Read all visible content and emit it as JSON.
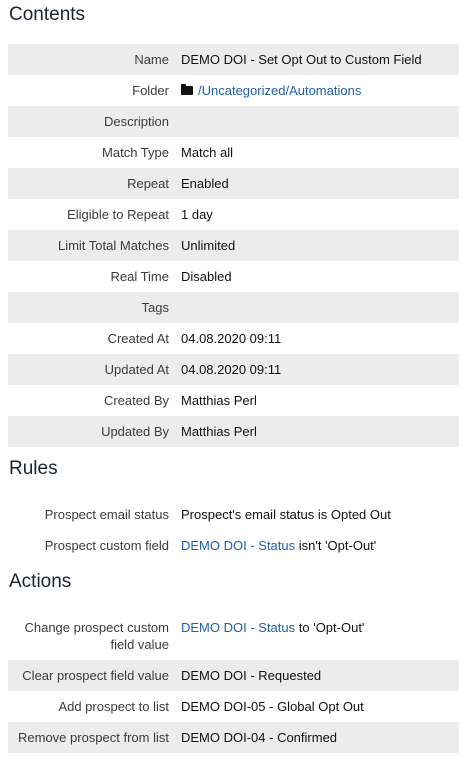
{
  "sections": {
    "contents": "Contents",
    "rules": "Rules",
    "actions": "Actions"
  },
  "contents": [
    {
      "label": "Name",
      "value": "DEMO DOI - Set Opt Out to Custom Field"
    },
    {
      "label": "Folder",
      "value": "/Uncategorized/Automations",
      "icon": "folder-icon"
    },
    {
      "label": "Description",
      "value": ""
    },
    {
      "label": "Match Type",
      "value": "Match all"
    },
    {
      "label": "Repeat",
      "value": "Enabled"
    },
    {
      "label": "Eligible to Repeat",
      "value": "1 day"
    },
    {
      "label": "Limit Total Matches",
      "value": "Unlimited"
    },
    {
      "label": "Real Time",
      "value": "Disabled"
    },
    {
      "label": "Tags",
      "value": ""
    },
    {
      "label": "Created At",
      "value": "04.08.2020 09:11"
    },
    {
      "label": "Updated At",
      "value": "04.08.2020 09:11"
    },
    {
      "label": "Created By",
      "value": "Matthias Perl"
    },
    {
      "label": "Updated By",
      "value": "Matthias Perl"
    }
  ],
  "rules": [
    {
      "label": "Prospect email status",
      "value": "Prospect's email status is Opted Out"
    },
    {
      "label": "Prospect custom field",
      "link": "DEMO DOI - Status",
      "suffix": " isn't 'Opt-Out'"
    }
  ],
  "actions": [
    {
      "label_line1": "Change prospect custom",
      "label_line2": "field value",
      "link": "DEMO DOI - Status",
      "suffix": " to 'Opt-Out'"
    },
    {
      "label": "Clear prospect field value",
      "link": "DEMO DOI - Requested"
    },
    {
      "label": "Add prospect to list",
      "link": "DEMO DOI-05 - Global Opt Out"
    },
    {
      "label": "Remove prospect from list",
      "link": "DEMO DOI-04 - Confirmed"
    }
  ],
  "colors": {
    "link": "#1f5fab",
    "row_shade": "#ececec",
    "heading": "#1a2430"
  }
}
